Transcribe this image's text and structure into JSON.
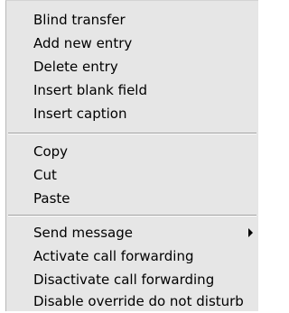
{
  "context_menu": {
    "group1": {
      "blind_transfer": "Blind transfer",
      "add_new_entry": "Add new entry",
      "delete_entry": "Delete entry",
      "insert_blank_field": "Insert blank field",
      "insert_caption": "Insert caption"
    },
    "group2": {
      "copy": "Copy",
      "cut": "Cut",
      "paste": "Paste"
    },
    "group3": {
      "send_message": "Send message",
      "send_message_has_submenu": true,
      "activate_call_forwarding": "Activate call forwarding",
      "deactivate_call_forwarding": "Disactivate call forwarding",
      "disable_override_dnd": "Disable override do not disturb"
    }
  },
  "icons": {
    "submenu_arrow": "chevron-right-icon"
  },
  "colors": {
    "menu_background": "#e6e6e6",
    "separator_dark": "#a0a0a0",
    "separator_light": "#ffffff",
    "text": "#000000"
  }
}
